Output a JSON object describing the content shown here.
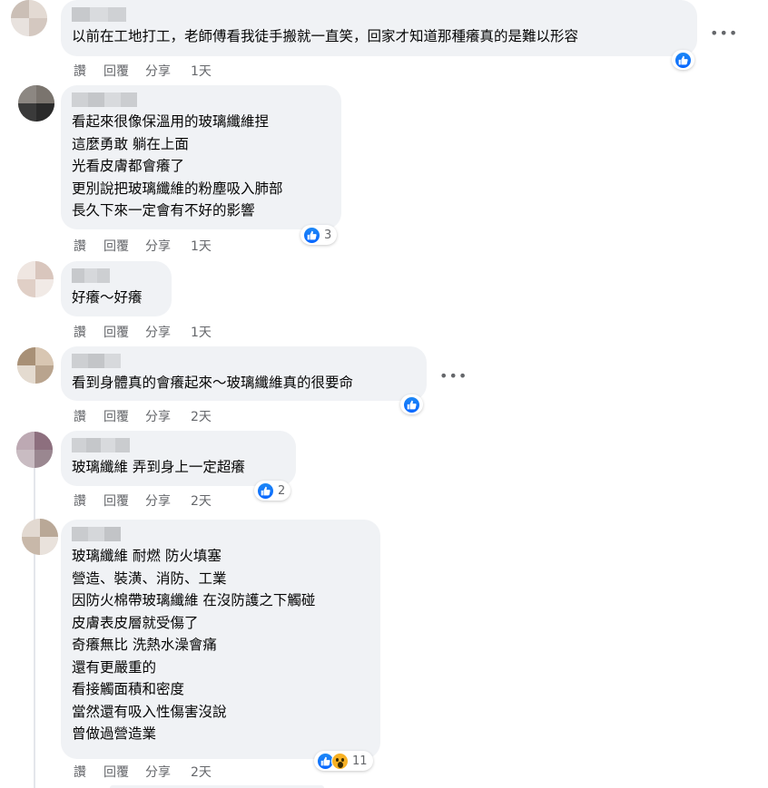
{
  "actions": {
    "like": "讚",
    "reply": "回覆",
    "share": "分享"
  },
  "more_label": "•••",
  "colors": {
    "like_blue": "#0866ff",
    "bubble_bg": "#f0f2f5",
    "meta_gray": "#65676b",
    "wow_yellow": "#f7b125"
  },
  "comments": [
    {
      "lines": [
        "以前在工地打工，老師傅看我徒手搬就一直笑，回家才知道那種癢真的是難以形容"
      ],
      "time": "1天",
      "reaction_count": ""
    },
    {
      "lines": [
        "看起來很像保溫用的玻璃纖維捏",
        "這麼勇敢 躺在上面",
        "光看皮膚都會癢了",
        "更別說把玻璃纖維的粉塵吸入肺部",
        "長久下來一定會有不好的影響"
      ],
      "time": "1天",
      "reaction_count": "3"
    },
    {
      "lines": [
        "好癢～好癢"
      ],
      "time": "1天",
      "reaction_count": ""
    },
    {
      "lines": [
        "看到身體真的會癢起來～玻璃纖維真的很要命"
      ],
      "time": "2天",
      "reaction_count": ""
    },
    {
      "lines": [
        "玻璃纖維 弄到身上一定超癢"
      ],
      "time": "2天",
      "reaction_count": "2"
    },
    {
      "lines": [
        "玻璃纖維 耐燃 防火填塞",
        "營造、裝潢、消防、工業",
        "因防火棉帶玻璃纖維 在沒防護之下觸碰",
        "皮膚表皮層就受傷了",
        "奇癢無比 洗熱水澡會痛",
        "還有更嚴重的",
        "看接觸面積和密度",
        "當然還有吸入性傷害沒說",
        "曾做過營造業"
      ],
      "time": "2天",
      "reaction_count": "11"
    }
  ]
}
